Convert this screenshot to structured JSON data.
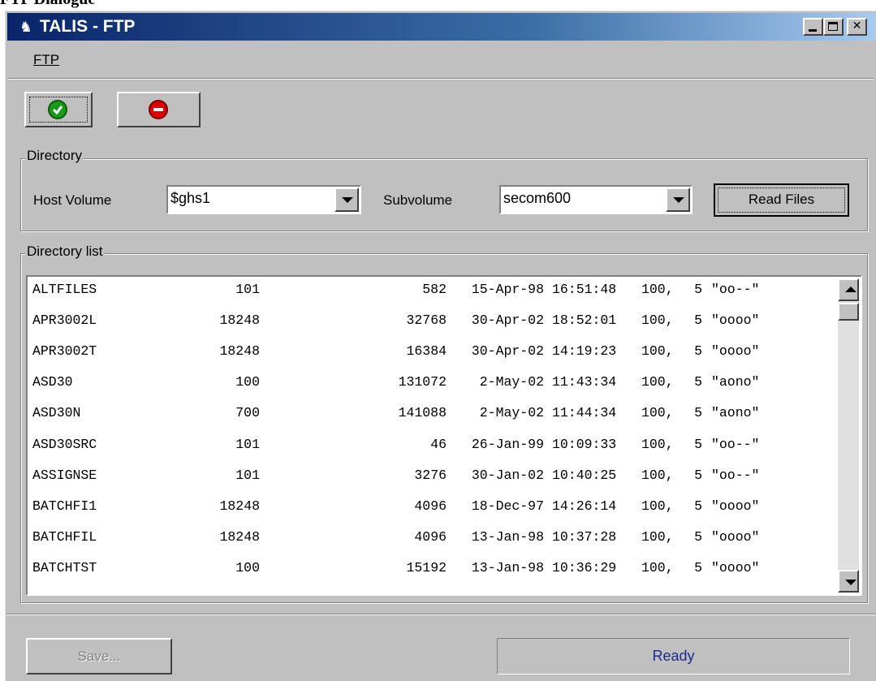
{
  "page_caption": "FTP Dialogue",
  "window": {
    "title": "TALIS - FTP",
    "controls": {
      "minimize_icon": "minimize-icon",
      "maximize_icon": "maximize-icon",
      "close_icon": "close-icon"
    }
  },
  "menu": {
    "items": [
      {
        "label": "FTP"
      }
    ]
  },
  "toolbar": {
    "ok_icon": "check-circle-icon",
    "stop_icon": "stop-circle-icon",
    "colors": {
      "ok": "#1a9a1a",
      "stop": "#e00000"
    }
  },
  "directory": {
    "title": "Directory",
    "host_volume_label": "Host Volume",
    "host_volume_value": "$ghs1",
    "subvolume_label": "Subvolume",
    "subvolume_value": "secom600",
    "read_files_label": "Read Files"
  },
  "directory_list": {
    "title": "Directory list",
    "rows": [
      {
        "name": "ALTFILES",
        "code": "101",
        "size": "582",
        "date": "15-Apr-98",
        "time": "16:51:48",
        "owner": "100,",
        "group": "5",
        "perm": "\"oo--\""
      },
      {
        "name": "APR3002L",
        "code": "18248",
        "size": "32768",
        "date": "30-Apr-02",
        "time": "18:52:01",
        "owner": "100,",
        "group": "5",
        "perm": "\"oooo\""
      },
      {
        "name": "APR3002T",
        "code": "18248",
        "size": "16384",
        "date": "30-Apr-02",
        "time": "14:19:23",
        "owner": "100,",
        "group": "5",
        "perm": "\"oooo\""
      },
      {
        "name": "ASD30",
        "code": "100",
        "size": "131072",
        "date": "2-May-02",
        "time": "11:43:34",
        "owner": "100,",
        "group": "5",
        "perm": "\"aono\""
      },
      {
        "name": "ASD30N",
        "code": "700",
        "size": "141088",
        "date": "2-May-02",
        "time": "11:44:34",
        "owner": "100,",
        "group": "5",
        "perm": "\"aono\""
      },
      {
        "name": "ASD30SRC",
        "code": "101",
        "size": "46",
        "date": "26-Jan-99",
        "time": "10:09:33",
        "owner": "100,",
        "group": "5",
        "perm": "\"oo--\""
      },
      {
        "name": "ASSIGNSE",
        "code": "101",
        "size": "3276",
        "date": "30-Jan-02",
        "time": "10:40:25",
        "owner": "100,",
        "group": "5",
        "perm": "\"oo--\""
      },
      {
        "name": "BATCHFI1",
        "code": "18248",
        "size": "4096",
        "date": "18-Dec-97",
        "time": "14:26:14",
        "owner": "100,",
        "group": "5",
        "perm": "\"oooo\""
      },
      {
        "name": "BATCHFIL",
        "code": "18248",
        "size": "4096",
        "date": "13-Jan-98",
        "time": "10:37:28",
        "owner": "100,",
        "group": "5",
        "perm": "\"oooo\""
      },
      {
        "name": "BATCHTST",
        "code": "100",
        "size": "15192",
        "date": "13-Jan-98",
        "time": "10:36:29",
        "owner": "100,",
        "group": "5",
        "perm": "\"oooo\""
      }
    ]
  },
  "footer": {
    "save_label": "Save...",
    "status": "Ready"
  }
}
